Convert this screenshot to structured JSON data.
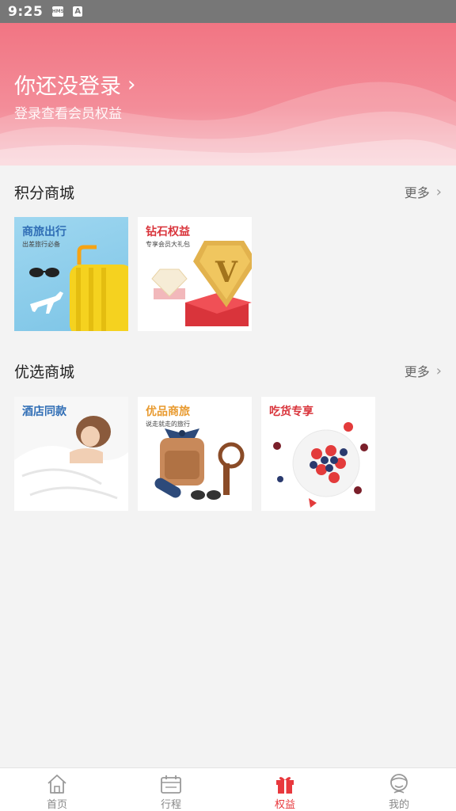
{
  "status_bar": {
    "time": "9:25",
    "icon1": "HMS",
    "icon2": "A"
  },
  "header": {
    "login_title": "你还没登录",
    "login_subtitle": "登录查看会员权益"
  },
  "points_mall": {
    "title": "积分商城",
    "more_label": "更多",
    "cards": [
      {
        "title": "商旅出行",
        "subtitle": "出差旅行必备",
        "title_color": "#2f6db5"
      },
      {
        "title": "钻石权益",
        "subtitle": "专享会员大礼包",
        "title_color": "#d9343b"
      }
    ]
  },
  "preferred_mall": {
    "title": "优选商城",
    "more_label": "更多",
    "cards": [
      {
        "title": "酒店同款",
        "subtitle": "",
        "title_color": "#2f6db5"
      },
      {
        "title": "优品商旅",
        "subtitle": "说走就走的旅行",
        "title_color": "#e89a2f"
      },
      {
        "title": "吃货专享",
        "subtitle": "",
        "title_color": "#d9343b"
      }
    ]
  },
  "tabbar": {
    "tabs": [
      {
        "label": "首页",
        "icon": "home-icon",
        "active": false
      },
      {
        "label": "行程",
        "icon": "calendar-icon",
        "active": false
      },
      {
        "label": "权益",
        "icon": "gift-icon",
        "active": true
      },
      {
        "label": "我的",
        "icon": "profile-icon",
        "active": false
      }
    ]
  },
  "colors": {
    "accent": "#e8383d",
    "header_top": "#f27583",
    "header_bottom": "#f7b6bf"
  }
}
